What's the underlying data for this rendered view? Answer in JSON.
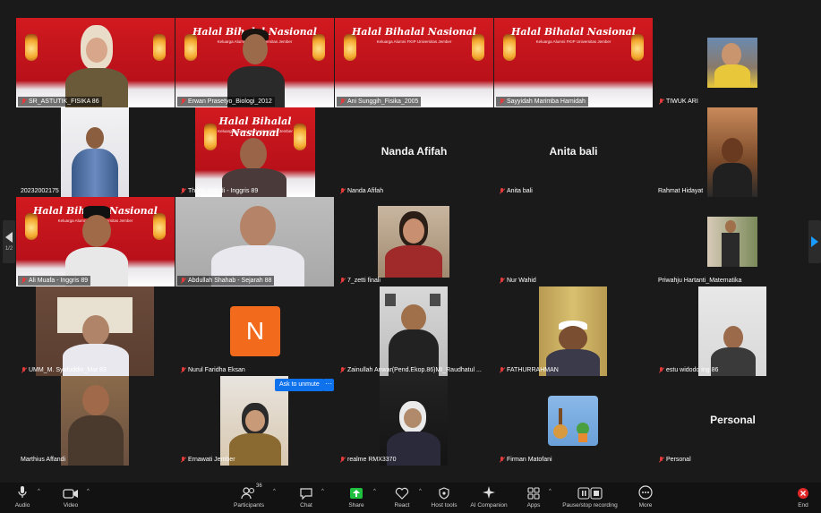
{
  "meeting": {
    "banner": {
      "title": "Halal Bihalal Nasional",
      "subtitle": "Keluarga Alumni FKIP Universitas Jember"
    },
    "page_indicator": "1/2",
    "ask_to_unmute": "Ask to unmute",
    "ask_more": "···",
    "tiles": [
      {
        "label": "SR_ASTUTIK_FISIKA 86",
        "muted": true,
        "speaking": false
      },
      {
        "label": "Erwan Prasetyo_Biologi_2012",
        "muted": true,
        "speaking": true
      },
      {
        "label": "Ani Sunggih_Fisika_2005",
        "muted": true,
        "speaking": false
      },
      {
        "label": "Sayyidah Marimba Hamidah",
        "muted": true,
        "speaking": false
      },
      {
        "label": "TIWUK ARI",
        "muted": true,
        "speaking": false
      },
      {
        "label": "20232002175",
        "muted": false,
        "speaking": false
      },
      {
        "label": "Thohir Afandi - Inggris 89",
        "muted": true,
        "speaking": false
      },
      {
        "label": "Nanda Afifah",
        "muted": true,
        "speaking": false,
        "bigname": "Nanda Afifah"
      },
      {
        "label": "Anita bali",
        "muted": true,
        "speaking": false,
        "bigname": "Anita bali"
      },
      {
        "label": "Rahmat Hidayat",
        "muted": false,
        "speaking": false
      },
      {
        "label": "Ali Muafa - Inggris 89",
        "muted": true,
        "speaking": false
      },
      {
        "label": "Abdullah Shahab - Sejarah 88",
        "muted": true,
        "speaking": false
      },
      {
        "label": "7_zetti finali",
        "muted": true,
        "speaking": false
      },
      {
        "label": "Nur Wahid",
        "muted": true,
        "speaking": false
      },
      {
        "label": "Priwahju Hartanti_Matematika",
        "muted": false,
        "speaking": false
      },
      {
        "label": "UMM_M. Syafuddin_Mat 83",
        "muted": true,
        "speaking": false
      },
      {
        "label": "Nurul Faridha Eksan",
        "muted": true,
        "speaking": false,
        "avatar_letter": "N"
      },
      {
        "label": "Zainullah Anwar(Pend.Ekop.86)MI_Raudhatul ...",
        "muted": true,
        "speaking": false
      },
      {
        "label": "FATHURRAHMAN",
        "muted": true,
        "speaking": false
      },
      {
        "label": "estu widodo ing 86",
        "muted": true,
        "speaking": false
      },
      {
        "label": "Marthius Affandi",
        "muted": false,
        "speaking": false
      },
      {
        "label": "Ernawati Jember",
        "muted": true,
        "speaking": false
      },
      {
        "label": "realme RMX3370",
        "muted": true,
        "speaking": false
      },
      {
        "label": "Firman Matofani",
        "muted": true,
        "speaking": false
      },
      {
        "label": "Personal",
        "muted": true,
        "speaking": false,
        "bigname": "Personal"
      }
    ]
  },
  "toolbar": {
    "audio": "Audio",
    "video": "Video",
    "participants": "Participants",
    "participants_count": "36",
    "chat": "Chat",
    "share": "Share",
    "react": "React",
    "host_tools": "Host tools",
    "ai_companion": "AI Companion",
    "apps": "Apps",
    "pause_recording": "Pause/stop recording",
    "more": "More",
    "end": "End"
  },
  "colors": {
    "share": "#1fbf3f",
    "end": "#e02828",
    "accent": "#0e72ed",
    "speaking": "#35c24a"
  }
}
